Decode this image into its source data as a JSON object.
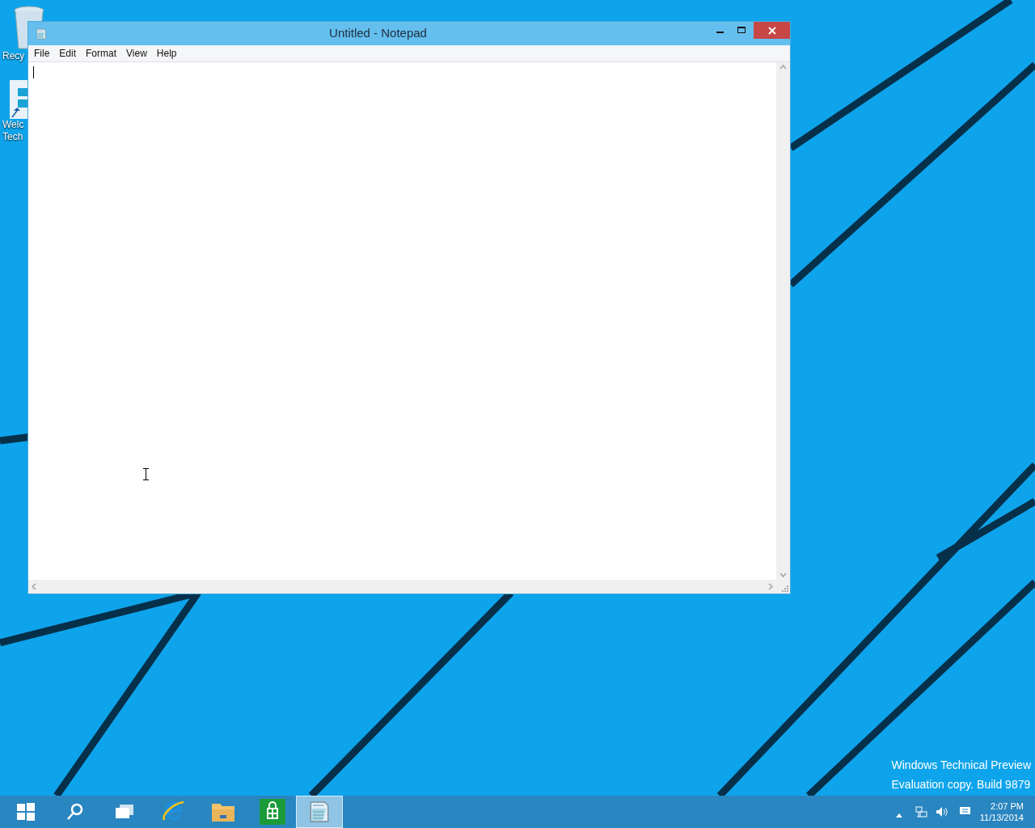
{
  "desktop": {
    "icons": [
      {
        "kind": "recycle-bin",
        "lines": [
          "Recy"
        ]
      },
      {
        "kind": "shortcut",
        "lines": [
          "Welc",
          "Tech"
        ]
      }
    ],
    "watermark": [
      "Windows Technical Preview",
      "Evaluation copy. Build 9879"
    ]
  },
  "window": {
    "title": "Untitled - Notepad",
    "menu": [
      {
        "label": "File"
      },
      {
        "label": "Edit"
      },
      {
        "label": "Format"
      },
      {
        "label": "View"
      },
      {
        "label": "Help"
      }
    ]
  },
  "taskbar": {
    "apps": [
      {
        "kind": "start",
        "selected": false
      },
      {
        "kind": "search",
        "selected": false
      },
      {
        "kind": "task-view",
        "selected": false
      },
      {
        "kind": "browser",
        "selected": false
      },
      {
        "kind": "explorer",
        "selected": false
      },
      {
        "kind": "store",
        "selected": false
      },
      {
        "kind": "notepad",
        "selected": true
      }
    ],
    "tray": {
      "time": "2:07 PM",
      "date": "11/13/2014"
    }
  }
}
